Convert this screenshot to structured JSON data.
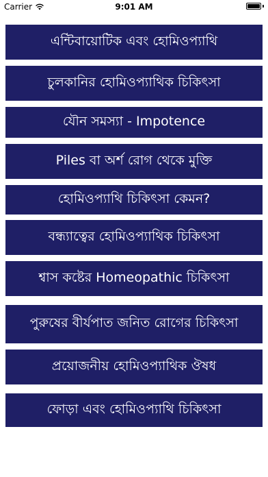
{
  "status_bar": {
    "carrier": "Carrier",
    "time": "9:01 AM",
    "icons": [
      "wifi-icon",
      "battery-icon"
    ]
  },
  "colors": {
    "button_bg": "#1f1f66",
    "button_text": "#ffffff"
  },
  "menu": {
    "items": [
      {
        "label": "এন্টিবায়োটিক এবং হোমিওপ্যাথি"
      },
      {
        "label": "চুলকানির হোমিওপ্যাথিক চিকিৎসা"
      },
      {
        "label": "যৌন সমস্যা - Impotence"
      },
      {
        "label": "Piles বা অর্শ রোগ থেকে মুক্তি"
      },
      {
        "label": "হোমিওপ্যাথি চিকিৎসা কেমন?"
      },
      {
        "label": "বন্ধ্যাত্বের হোমিওপ্যাথিক চিকিৎসা"
      },
      {
        "label": "শ্বাস কষ্টের Homeopathic চিকিৎসা"
      },
      {
        "label": "পুরুষের বীর্যপাত জনিত রোগের চিকিৎসা"
      },
      {
        "label": "প্রয়োজনীয় হোমিওপ্যাথিক ঔষধ"
      },
      {
        "label": "ফোড়া এবং হোমিওপ্যাথি চিকিৎসা"
      }
    ]
  }
}
